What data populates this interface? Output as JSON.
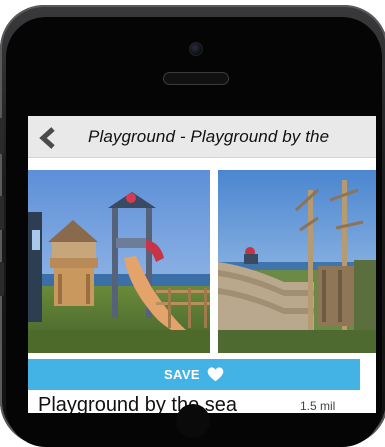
{
  "header": {
    "back_icon": "chevron-left-icon",
    "title": "Playground - Playground by the"
  },
  "photos": [
    {
      "description_icon": "playground-photo-slide"
    },
    {
      "description_icon": "playground-photo-ship"
    }
  ],
  "save_button": {
    "label": "SAVE",
    "icon": "heart-icon",
    "color": "#43b3e6"
  },
  "place": {
    "name": "Playground by the sea",
    "distance": "1.5 mil"
  }
}
